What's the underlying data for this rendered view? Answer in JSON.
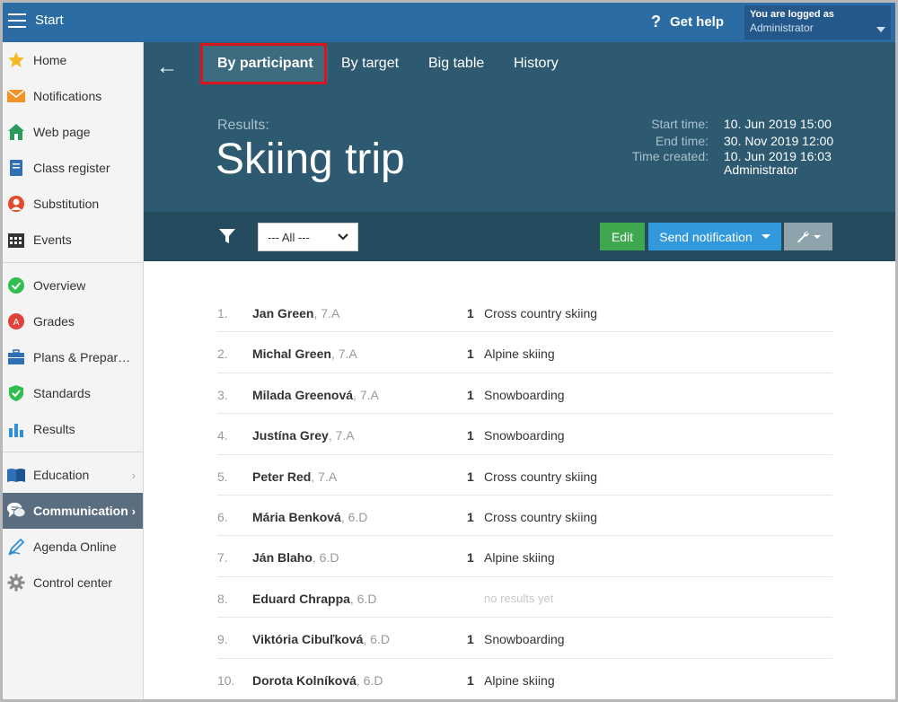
{
  "topbar": {
    "start_label": "Start",
    "help_label": "Get help",
    "logged_in_label": "You are logged as",
    "user_name": "Administrator"
  },
  "sidebar": {
    "items": [
      {
        "label": "Home",
        "icon": "star-icon",
        "color": "#f5b921"
      },
      {
        "label": "Notifications",
        "icon": "envelope-icon",
        "color": "#f0932b"
      },
      {
        "label": "Web page",
        "icon": "house-icon",
        "color": "#2b9a5e"
      },
      {
        "label": "Class register",
        "icon": "book-icon",
        "color": "#2f6fb5"
      },
      {
        "label": "Substitution",
        "icon": "person-icon",
        "color": "#e24a2b"
      },
      {
        "label": "Events",
        "icon": "calendar-icon",
        "color": "#333333"
      },
      {
        "label": "Overview",
        "icon": "check-circle-icon",
        "color": "#2fbf4f"
      },
      {
        "label": "Grades",
        "icon": "grade-icon",
        "color": "#e0413a"
      },
      {
        "label": "Plans & Preparations",
        "icon": "briefcase-icon",
        "color": "#2f6fb5"
      },
      {
        "label": "Standards",
        "icon": "shield-check-icon",
        "color": "#2fbf4f"
      },
      {
        "label": "Results",
        "icon": "bar-chart-icon",
        "color": "#2f8fd8"
      },
      {
        "label": "Education",
        "icon": "open-book-icon",
        "color": "#2f6fb5"
      },
      {
        "label": "Communication",
        "icon": "chat-icon",
        "color": "#ffffff"
      },
      {
        "label": "Agenda Online",
        "icon": "pen-icon",
        "color": "#2f8fd8"
      },
      {
        "label": "Control center",
        "icon": "gear-icon",
        "color": "#8a8a8a"
      }
    ]
  },
  "tabs": [
    {
      "label": "By participant"
    },
    {
      "label": "By target"
    },
    {
      "label": "Big table"
    },
    {
      "label": "History"
    }
  ],
  "header": {
    "results_label": "Results:",
    "title": "Skiing trip",
    "meta": {
      "start_label": "Start time:",
      "start_value": "10. Jun 2019 15:00",
      "end_label": "End time:",
      "end_value": "30. Nov 2019 12:00",
      "created_label": "Time created:",
      "created_value": "10. Jun 2019 16:03",
      "created_by": "Administrator"
    }
  },
  "toolbar": {
    "filter_value": "--- All ---",
    "edit_label": "Edit",
    "send_label": "Send notification"
  },
  "participants": [
    {
      "num": "1.",
      "name": "Jan Green",
      "class": ", 7.A",
      "score": "1",
      "target": "Cross country skiing"
    },
    {
      "num": "2.",
      "name": "Michal Green",
      "class": ", 7.A",
      "score": "1",
      "target": "Alpine skiing"
    },
    {
      "num": "3.",
      "name": "Milada Greenová",
      "class": ", 7.A",
      "score": "1",
      "target": "Snowboarding"
    },
    {
      "num": "4.",
      "name": "Justína Grey",
      "class": ", 7.A",
      "score": "1",
      "target": "Snowboarding"
    },
    {
      "num": "5.",
      "name": "Peter Red",
      "class": ", 7.A",
      "score": "1",
      "target": "Cross country skiing"
    },
    {
      "num": "6.",
      "name": "Mária Benková",
      "class": ", 6.D",
      "score": "1",
      "target": "Cross country skiing"
    },
    {
      "num": "7.",
      "name": "Ján Blaho",
      "class": ", 6.D",
      "score": "1",
      "target": "Alpine skiing"
    },
    {
      "num": "8.",
      "name": "Eduard Chrappa",
      "class": ", 6.D",
      "score": "",
      "target": "",
      "no_result": "no results yet"
    },
    {
      "num": "9.",
      "name": "Viktória Cibuľková",
      "class": ", 6.D",
      "score": "1",
      "target": "Snowboarding"
    },
    {
      "num": "10.",
      "name": "Dorota Kolníková",
      "class": ", 6.D",
      "score": "1",
      "target": "Alpine skiing"
    }
  ],
  "colors": {
    "topbar": "#2c6ca5",
    "header": "#2d5a70",
    "toolbar": "#244b5e",
    "edit": "#3fa84e",
    "send": "#3399dd",
    "highlight": "#d9141b"
  }
}
